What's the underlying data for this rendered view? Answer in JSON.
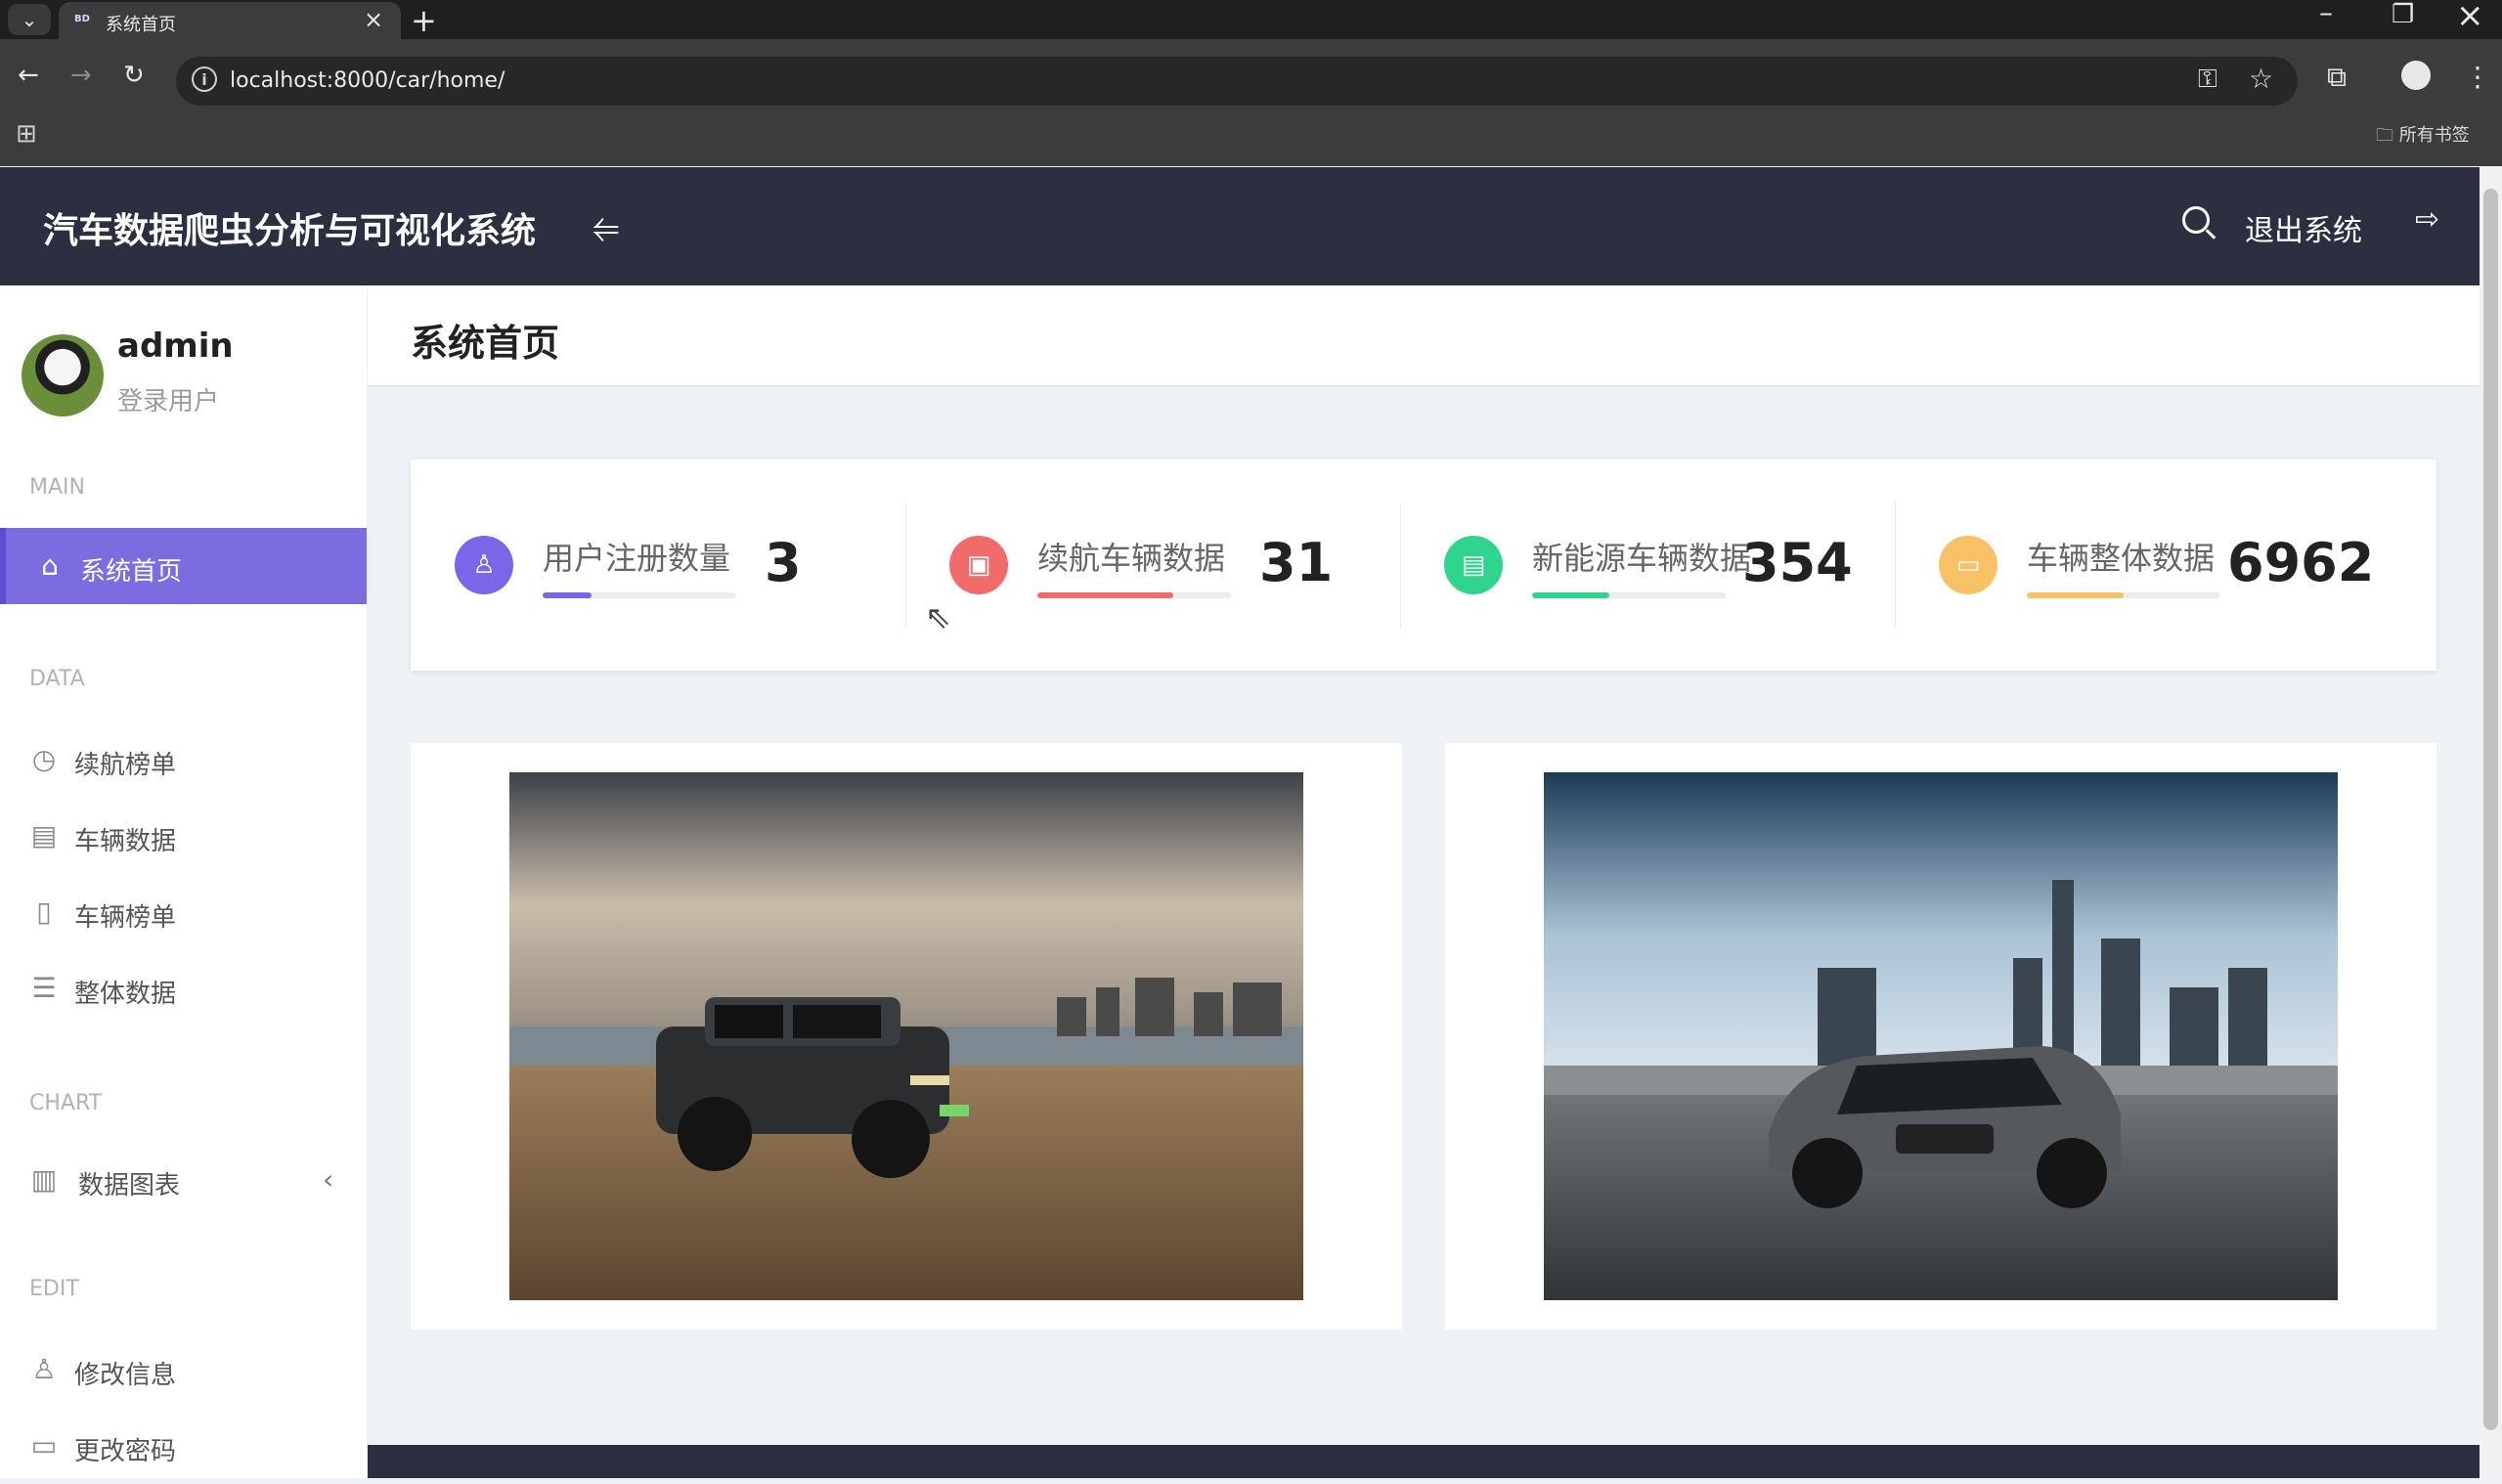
{
  "browser": {
    "tab_title": "系统首页",
    "tab_favicon": "BD",
    "url": "localhost:8000/car/home/",
    "bookmarks_label": "所有书签"
  },
  "header": {
    "app_title": "汽车数据爬虫分析与可视化系统",
    "logout_label": "退出系统"
  },
  "user": {
    "name": "admin",
    "role": "登录用户"
  },
  "sidebar": {
    "sections": {
      "main": "MAIN",
      "data": "DATA",
      "chart": "CHART",
      "edit": "EDIT"
    },
    "items": [
      {
        "label": "系统首页",
        "icon": "home-icon"
      },
      {
        "label": "续航榜单",
        "icon": "clock-icon"
      },
      {
        "label": "车辆数据",
        "icon": "table-icon"
      },
      {
        "label": "车辆榜单",
        "icon": "report-icon"
      },
      {
        "label": "整体数据",
        "icon": "list-icon"
      },
      {
        "label": "数据图表",
        "icon": "bar-chart-icon"
      },
      {
        "label": "修改信息",
        "icon": "user-icon"
      },
      {
        "label": "更改密码",
        "icon": "password-icon"
      }
    ]
  },
  "page": {
    "title": "系统首页"
  },
  "stats": [
    {
      "label": "用户注册数量",
      "value": "3",
      "color": "#7a66e6",
      "progress": 0.25,
      "icon": "user-icon"
    },
    {
      "label": "续航车辆数据",
      "value": "31",
      "color": "#f16b6b",
      "progress": 0.7,
      "icon": "clipboard-icon"
    },
    {
      "label": "新能源车辆数据",
      "value": "354",
      "color": "#2fd58c",
      "progress": 0.4,
      "icon": "document-icon"
    },
    {
      "label": "车辆整体数据",
      "value": "6962",
      "color": "#f8c165",
      "progress": 0.5,
      "icon": "id-card-icon"
    }
  ],
  "colors": {
    "header_bg": "#2c2f3f",
    "accent": "#7b6de0",
    "page_bg": "#eef2f6"
  }
}
